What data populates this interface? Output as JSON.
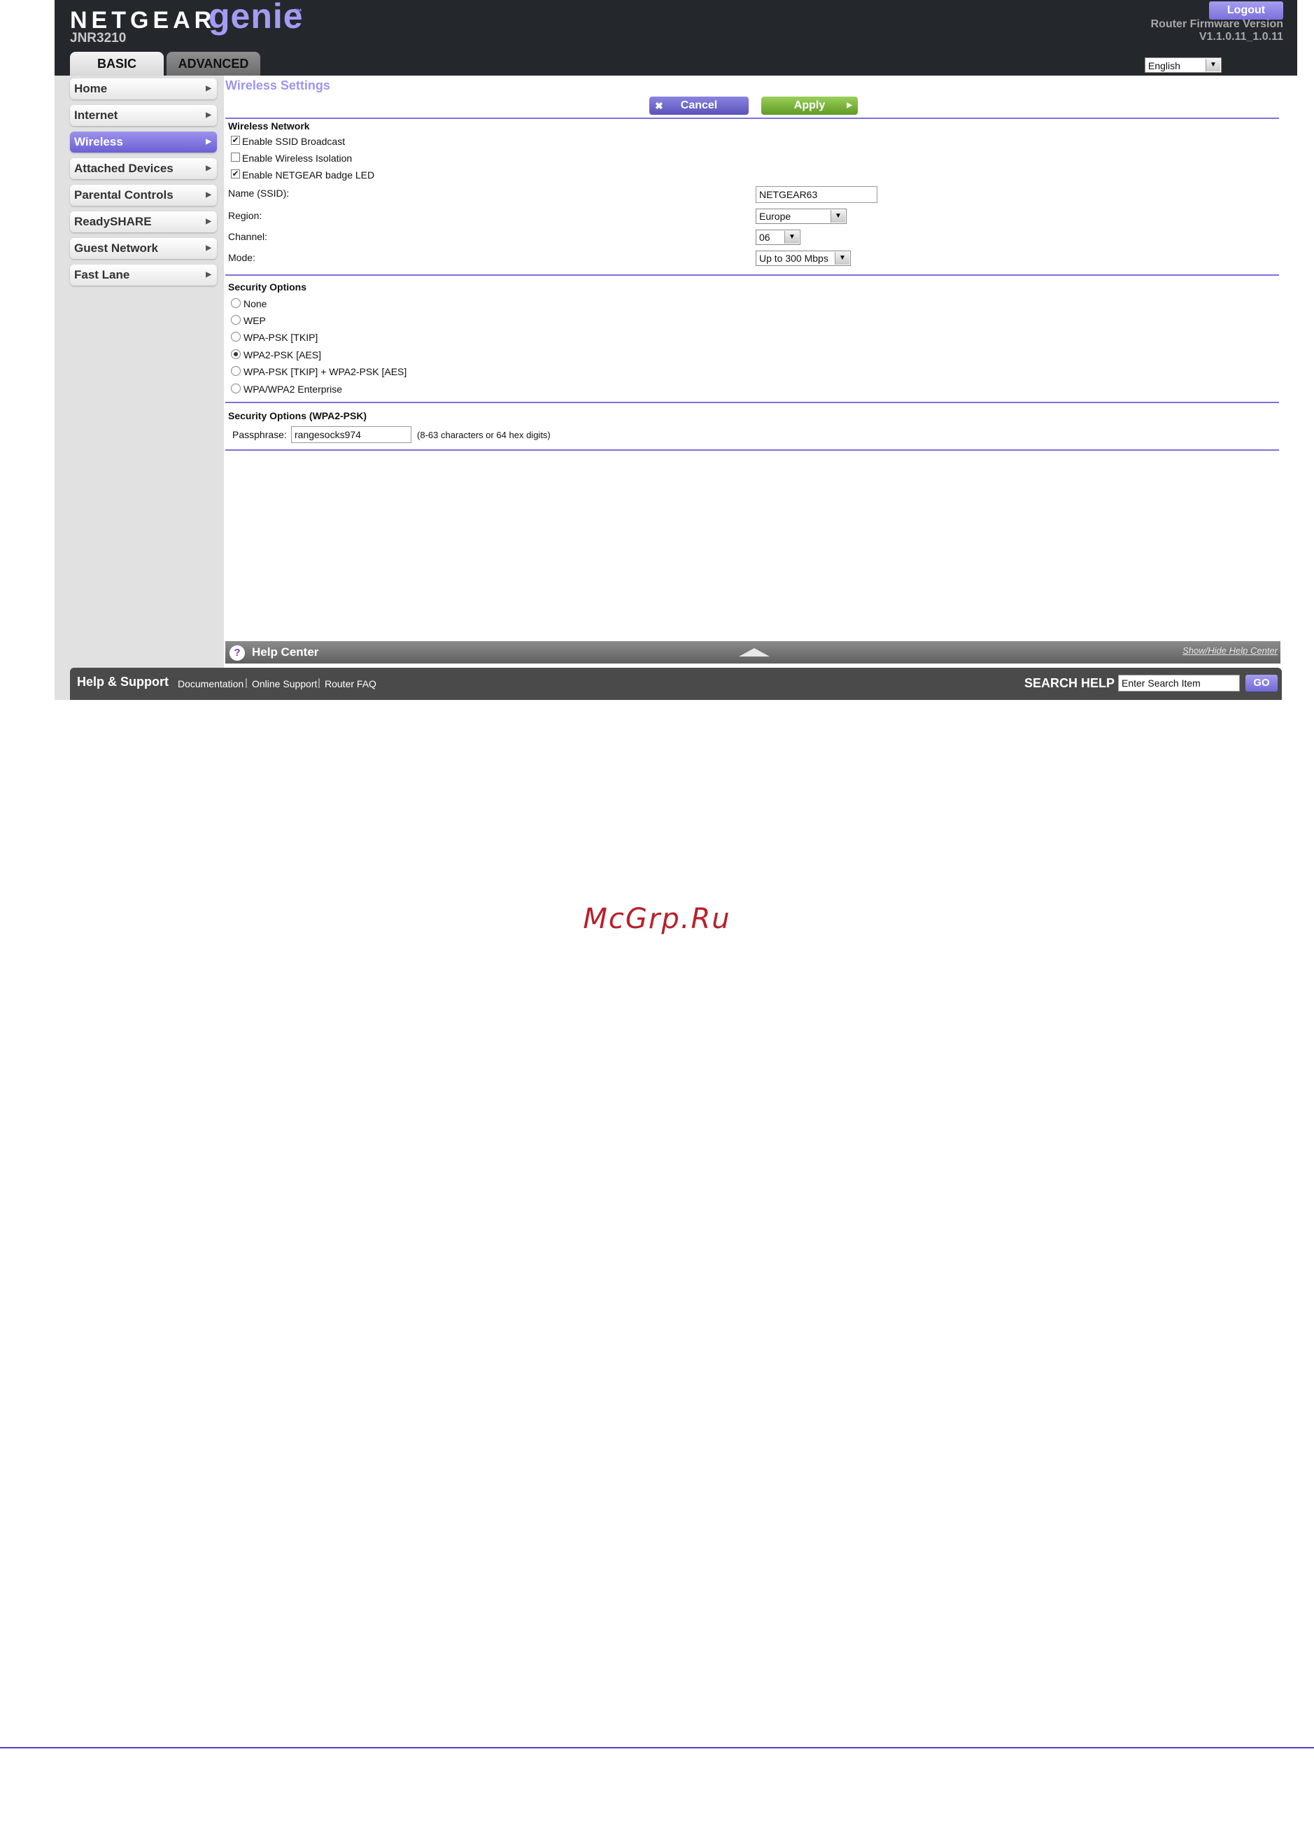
{
  "brand": {
    "netgear": "NETGEAR",
    "genie": "genie",
    "tm": "™",
    "model": "JNR3210"
  },
  "header": {
    "tabs": [
      {
        "label": "BASIC",
        "active": true
      },
      {
        "label": "ADVANCED",
        "active": false
      }
    ],
    "logout_label": "Logout",
    "firmware_label": "Router Firmware Version",
    "firmware_version": "V1.1.0.11_1.0.11",
    "language": "English"
  },
  "sidebar": {
    "items": [
      {
        "label": "Home",
        "active": false
      },
      {
        "label": "Internet",
        "active": false
      },
      {
        "label": "Wireless",
        "active": true
      },
      {
        "label": "Attached Devices",
        "active": false
      },
      {
        "label": "Parental Controls",
        "active": false
      },
      {
        "label": "ReadySHARE",
        "active": false
      },
      {
        "label": "Guest Network",
        "active": false
      },
      {
        "label": "Fast Lane",
        "active": false
      }
    ]
  },
  "page": {
    "title": "Wireless Settings",
    "cancel_label": "Cancel",
    "apply_label": "Apply"
  },
  "wireless_network": {
    "title": "Wireless Network",
    "checkboxes": [
      {
        "label": "Enable SSID Broadcast",
        "checked": true
      },
      {
        "label": "Enable Wireless Isolation",
        "checked": false
      },
      {
        "label": "Enable NETGEAR badge LED",
        "checked": true
      }
    ],
    "ssid_label": "Name (SSID):",
    "ssid_value": "NETGEAR63",
    "region_label": "Region:",
    "region_value": "Europe",
    "channel_label": "Channel:",
    "channel_value": "06",
    "mode_label": "Mode:",
    "mode_value": "Up to 300 Mbps"
  },
  "security_options": {
    "title": "Security Options",
    "options": [
      {
        "label": "None",
        "selected": false
      },
      {
        "label": "WEP",
        "selected": false
      },
      {
        "label": "WPA-PSK [TKIP]",
        "selected": false
      },
      {
        "label": "WPA2-PSK [AES]",
        "selected": true
      },
      {
        "label": "WPA-PSK [TKIP] + WPA2-PSK [AES]",
        "selected": false
      },
      {
        "label": "WPA/WPA2 Enterprise",
        "selected": false
      }
    ]
  },
  "security_wpa2": {
    "title": "Security Options (WPA2-PSK)",
    "passphrase_label": "Passphrase:",
    "passphrase_value": "rangesocks974",
    "hint": "(8-63 characters or 64 hex digits)"
  },
  "help_center": {
    "icon": "?",
    "title": "Help Center",
    "toggle": "Show/Hide Help Center"
  },
  "footer": {
    "title": "Help & Support",
    "links": [
      "Documentation",
      "Online Support",
      "Router FAQ"
    ],
    "separator": "|",
    "search_label": "SEARCH HELP",
    "search_value": "Enter Search Item",
    "go_label": "GO"
  },
  "watermark": "McGrp.Ru",
  "glyphs": {
    "arrow_right": "▶",
    "arrow_down": "▼",
    "close_x": "✖",
    "check": "✔"
  },
  "colors": {
    "accent": "#7b72dc",
    "header_bg": "#24282c",
    "apply_green": "#5e9a23",
    "watermark_red": "#b8202a"
  }
}
